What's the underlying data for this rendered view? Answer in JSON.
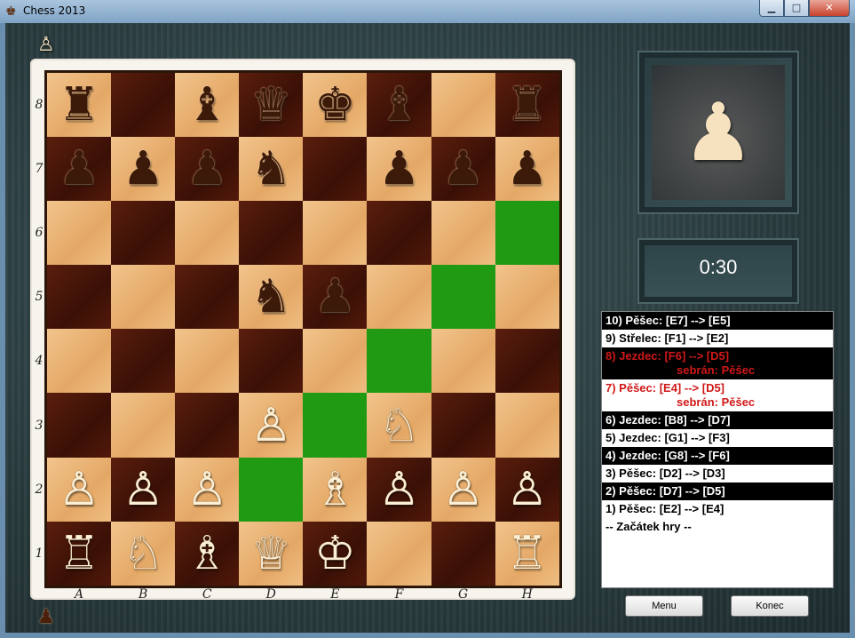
{
  "window": {
    "title": "Chess 2013",
    "minimize_glyph": "▁",
    "maximize_glyph": "□",
    "close_glyph": "✕"
  },
  "turn_indicators": {
    "top_glyph": "♙",
    "bottom_glyph": "♟"
  },
  "board": {
    "ranks": [
      "8",
      "7",
      "6",
      "5",
      "4",
      "3",
      "2",
      "1"
    ],
    "files": [
      "A",
      "B",
      "C",
      "D",
      "E",
      "F",
      "G",
      "H"
    ],
    "pieces": {
      "a8": "♜",
      "c8": "♝",
      "d8": "♛",
      "e8": "♚",
      "f8": "♝",
      "h8": "♜",
      "a7": "♟",
      "b7": "♟",
      "c7": "♟",
      "d7": "♞",
      "f7": "♟",
      "g7": "♟",
      "h7": "♟",
      "d5": "♞",
      "e5": "♟",
      "d3": "♙",
      "f3": "♘",
      "a2": "♙",
      "b2": "♙",
      "c2": "♙",
      "e2": "♗",
      "f2": "♙",
      "g2": "♙",
      "h2": "♙",
      "a1": "♖",
      "b1": "♘",
      "c1": "♗",
      "d1": "♕",
      "e1": "♔",
      "h1": "♖"
    },
    "highlights": [
      "h6",
      "g5",
      "f4",
      "e3",
      "d2"
    ],
    "colors": {
      "light": "#e8ad6c",
      "dark": "#4a1608",
      "highlight": "#1f9a12"
    }
  },
  "preview": {
    "piece_glyph": "♟",
    "icon": "pawn-icon"
  },
  "timer": {
    "value": "0:30"
  },
  "history": [
    {
      "text": "10) Pěšec: [E7] --> [E5]",
      "style": "black"
    },
    {
      "text": "9) Střelec: [F1] --> [E2]",
      "style": "white"
    },
    {
      "text": "8) Jezdec: [F6] --> [D5]",
      "sub": "sebrán: Pěšec",
      "style": "black cap"
    },
    {
      "text": "7) Pěšec: [E4] --> [D5]",
      "sub": "sebrán: Pěšec",
      "style": "white cap"
    },
    {
      "text": "6) Jezdec: [B8] --> [D7]",
      "style": "black"
    },
    {
      "text": "5) Jezdec: [G1] --> [F3]",
      "style": "white"
    },
    {
      "text": "4) Jezdec: [G8] --> [F6]",
      "style": "black"
    },
    {
      "text": "3) Pěšec: [D2] --> [D3]",
      "style": "white"
    },
    {
      "text": "2) Pěšec: [D7] --> [D5]",
      "style": "black"
    },
    {
      "text": "1) Pěšec: [E2] --> [E4]",
      "style": "white"
    },
    {
      "text": "-- Začátek hry --",
      "style": "white"
    }
  ],
  "buttons": {
    "menu": "Menu",
    "end": "Konec"
  }
}
